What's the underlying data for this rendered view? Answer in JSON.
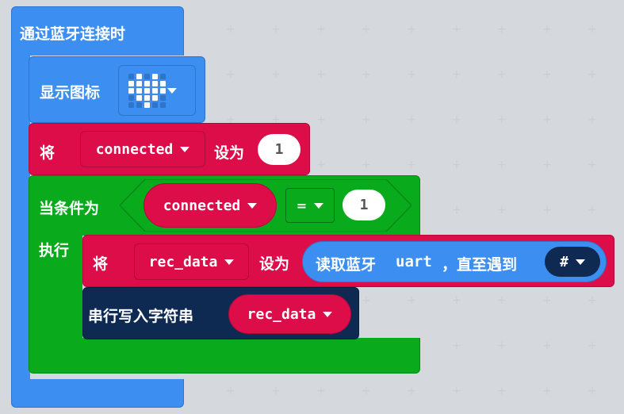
{
  "event": {
    "label": "通过蓝牙连接时"
  },
  "show_icon": {
    "label": "显示图标",
    "icon": "heart-icon"
  },
  "set1": {
    "prefix": "将",
    "variable": "connected",
    "mid": "设为",
    "value": "1"
  },
  "if_block": {
    "label": "当条件为",
    "do_label": "执行",
    "condition": {
      "left_var": "connected",
      "op": "=",
      "right_value": "1"
    }
  },
  "set2": {
    "prefix": "将",
    "variable": "rec_data",
    "mid": "设为",
    "read": {
      "label_a": "读取蓝牙",
      "label_b": "uart",
      "label_c": "，直至遇到",
      "delimiter": "#"
    }
  },
  "serial": {
    "label": "串行写入字符串",
    "variable": "rec_data"
  },
  "colors": {
    "event": "#3c8ff0",
    "variable": "#dd0d4a",
    "logic": "#09ab1c",
    "serial": "#0f2a52"
  }
}
